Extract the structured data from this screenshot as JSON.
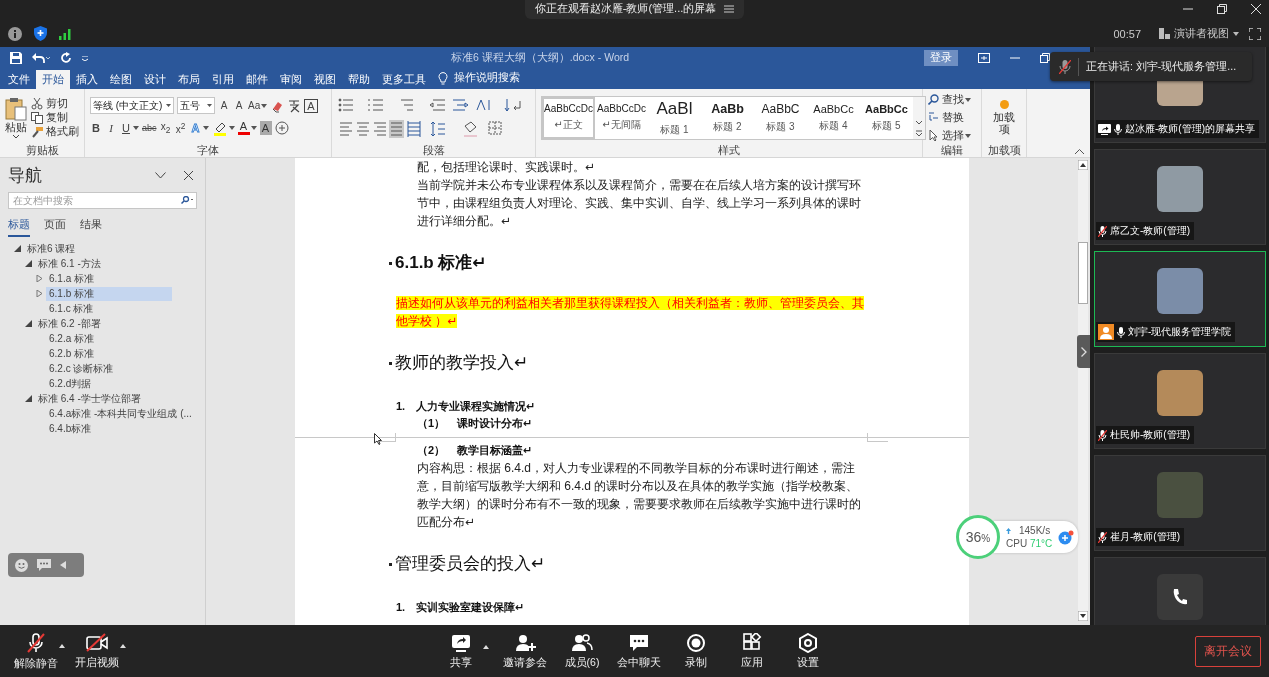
{
  "meeting": {
    "title": "你正在观看赵冰雁-教师(管理...的屏幕",
    "timer": "00:57",
    "view": "演讲者视图"
  },
  "speaking": {
    "muted": true,
    "text": "正在讲话: 刘宇-现代服务管理..."
  },
  "word": {
    "title": "标准6 课程大纲（大纲）.docx  -  Word",
    "login": "登录",
    "tabs": [
      {
        "label": "文件",
        "selected": false
      },
      {
        "label": "开始",
        "selected": true
      },
      {
        "label": "插入",
        "selected": false
      },
      {
        "label": "绘图",
        "selected": false
      },
      {
        "label": "设计",
        "selected": false
      },
      {
        "label": "布局",
        "selected": false
      },
      {
        "label": "引用",
        "selected": false
      },
      {
        "label": "邮件",
        "selected": false
      },
      {
        "label": "审阅",
        "selected": false
      },
      {
        "label": "视图",
        "selected": false
      },
      {
        "label": "帮助",
        "selected": false
      },
      {
        "label": "更多工具",
        "selected": false
      }
    ],
    "tell_me": "操作说明搜索",
    "clipboard": {
      "paste": "粘贴",
      "items": [
        {
          "kind": "cut",
          "label": "剪切"
        },
        {
          "kind": "copy",
          "label": "复制"
        },
        {
          "kind": "painter",
          "label": "格式刷"
        }
      ],
      "label": "剪贴板"
    },
    "font": {
      "name": "等线 (中文正文)",
      "size": "五号",
      "label": "字体",
      "top": [
        {
          "kind": "grow",
          "glyph": "A"
        },
        {
          "kind": "shrink",
          "glyph": "A"
        },
        {
          "kind": "case",
          "glyph": "Aa"
        },
        {
          "kind": "clear"
        },
        {
          "kind": "phonetic"
        },
        {
          "kind": "border",
          "glyph": "A"
        }
      ],
      "bottom": [
        {
          "kind": "bold",
          "glyph": "B"
        },
        {
          "kind": "italic",
          "glyph": "I"
        },
        {
          "kind": "underline",
          "glyph": "U"
        },
        {
          "kind": "strike",
          "glyph": "abc"
        },
        {
          "kind": "sub",
          "glyph": "x$_{2}$"
        },
        {
          "kind": "sup",
          "glyph": "x$^{2}$"
        },
        {
          "kind": "effects",
          "glyph": "A"
        },
        {
          "kind": "highlight"
        },
        {
          "kind": "color",
          "glyph": "A"
        },
        {
          "kind": "shading",
          "glyph": "A"
        },
        {
          "kind": "enclose"
        }
      ]
    },
    "paragraph": {
      "label": "段落"
    },
    "styles": {
      "label": "样式",
      "items": [
        {
          "preview": "AaBbCcDc",
          "name": "↵正文",
          "kind": "normal",
          "selected": true
        },
        {
          "preview": "AaBbCcDc",
          "name": "↵无间隔",
          "kind": "normal",
          "selected": false
        },
        {
          "preview": "AaBl",
          "name": "标题 1",
          "kind": "h1",
          "selected": false
        },
        {
          "preview": "AaBb",
          "name": "标题 2",
          "kind": "h2",
          "selected": false
        },
        {
          "preview": "AaBbC",
          "name": "标题 3",
          "kind": "h3",
          "selected": false
        },
        {
          "preview": "AaBbCc",
          "name": "标题 4",
          "kind": "h4",
          "selected": false
        },
        {
          "preview": "AaBbCc",
          "name": "标题 5",
          "kind": "h5",
          "selected": false
        }
      ]
    },
    "editing": {
      "label": "编辑",
      "items": [
        {
          "kind": "find",
          "label": "查找"
        },
        {
          "kind": "replace",
          "label": "替换"
        },
        {
          "kind": "select",
          "label": "选择"
        }
      ]
    },
    "addins": {
      "button": "加载项",
      "label": "加载项"
    }
  },
  "navigation": {
    "title": "导航",
    "placeholder": "在文档中搜索",
    "tabs": [
      {
        "label": "标题",
        "selected": true
      },
      {
        "label": "页面",
        "selected": false
      },
      {
        "label": "结果",
        "selected": false
      }
    ],
    "tree": [
      {
        "label": "标准6 课程",
        "expanded": true,
        "selected": false,
        "children": [
          {
            "label": "标准 6.1 -方法",
            "expanded": true,
            "selected": false,
            "children": [
              {
                "label": "6.1.a 标准",
                "expanded": false,
                "selected": false
              },
              {
                "label": "6.1.b 标准",
                "expanded": false,
                "selected": true
              },
              {
                "label": "6.1.c 标准",
                "selected": false
              }
            ]
          },
          {
            "label": "标准 6.2 -部署",
            "expanded": true,
            "selected": false,
            "children": [
              {
                "label": "6.2.a 标准",
                "selected": false
              },
              {
                "label": "6.2.b 标准",
                "selected": false
              },
              {
                "label": "6.2.c 诊断标准",
                "selected": false
              },
              {
                "label": "6.2.d判据",
                "selected": false
              }
            ]
          },
          {
            "label": "标准 6.4 -学士学位部署",
            "expanded": true,
            "selected": false,
            "children": [
              {
                "label": "6.4.a标准 -本科共同专业组成 (...",
                "selected": false
              },
              {
                "label": "6.4.b标准",
                "selected": false
              }
            ]
          }
        ]
      }
    ]
  },
  "document": {
    "pages": [
      [
        {
          "kind": "body",
          "text": "配，包括理论课时、实践课时。↵"
        },
        {
          "kind": "body",
          "text": "当前学院并未公布专业课程体系以及课程简介，需要在在后续人培方案的设计撰写环节中，由课程组负责人对理论、实践、集中实训、自学、线上学习一系列具体的课时进行详细分配。↵"
        },
        {
          "kind": "heading",
          "text": "6.1.b 标准↵"
        },
        {
          "kind": "highlight",
          "text": "描述如何从该单元的利益相关者那里获得课程投入（相关利益者：教师、管理委员会、其他学校 ）↵"
        },
        {
          "kind": "subheading",
          "text": "教师的教学投入↵"
        },
        {
          "kind": "numbered",
          "number": "1.",
          "text": "人力专业课程实施情况↵"
        },
        {
          "kind": "subnumbered",
          "number": "（1）",
          "text": "课时设计分布↵"
        }
      ],
      [
        {
          "kind": "subnumbered",
          "number": "（2）",
          "text": "教学目标涵盖↵"
        },
        {
          "kind": "body",
          "text": "内容构思：根据 6.4.d，对人力专业课程的不同教学目标的分布课时进行阐述，需注意，目前缩写版教学大纲和 6.4.d 的课时分布以及在具体的教学实施（指学校教案、教学大纲）的课时分布有不一致的现象，需要要求教师在后续教学实施中进行课时的匹配分布↵"
        },
        {
          "kind": "subheading",
          "text": "管理委员会的投入↵"
        },
        {
          "kind": "numbered",
          "number": "1.",
          "text": "实训实验室建设保障↵"
        }
      ]
    ]
  },
  "monitor": {
    "percent": "36",
    "unit": "%",
    "speed": "145K/s",
    "cpu_label": "CPU",
    "temperature": "71°C"
  },
  "participants": [
    {
      "kind": "screen-share",
      "muted": false,
      "name": "赵冰雁-教师(管理)的屏幕共享",
      "active": false
    },
    {
      "kind": "member",
      "muted": true,
      "name": "席乙文-教师(管理)",
      "active": false
    },
    {
      "kind": "host",
      "muted": false,
      "name": "刘宇-现代服务管理学院",
      "active": true
    },
    {
      "kind": "member",
      "muted": true,
      "name": "杜民帅-教师(管理)",
      "active": false
    },
    {
      "kind": "member",
      "muted": true,
      "name": "崔月-教师(管理)",
      "active": false
    },
    {
      "kind": "phone",
      "active": false
    }
  ],
  "toolbar": {
    "left": [
      {
        "kind": "mic",
        "label": "解除静音"
      },
      {
        "kind": "video",
        "label": "开启视频"
      }
    ],
    "center": [
      {
        "kind": "share",
        "label": "共享"
      },
      {
        "kind": "invite",
        "label": "邀请参会"
      },
      {
        "kind": "members",
        "label": "成员(6)"
      },
      {
        "kind": "chat",
        "label": "会中聊天"
      },
      {
        "kind": "record",
        "label": "录制"
      },
      {
        "kind": "apps",
        "label": "应用"
      },
      {
        "kind": "settings",
        "label": "设置"
      }
    ],
    "leave": "离开会议"
  }
}
